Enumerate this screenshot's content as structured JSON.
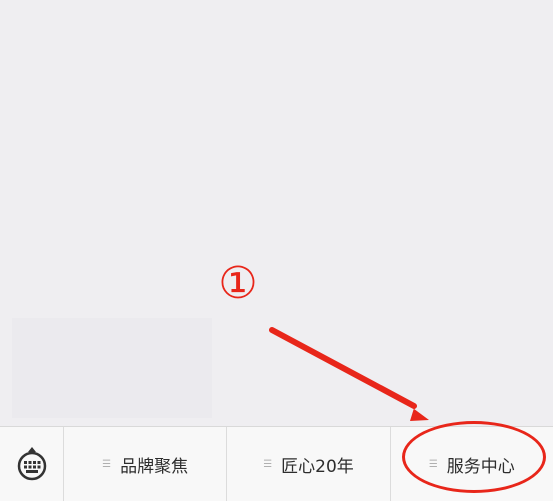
{
  "annotation": {
    "number": "①",
    "color": "#e8261a"
  },
  "menu": {
    "keyboard_icon": "keyboard-icon",
    "items": [
      {
        "icon": "menu-lines-icon",
        "label": "品牌聚焦"
      },
      {
        "icon": "menu-lines-icon",
        "label": "匠心20年"
      },
      {
        "icon": "menu-lines-icon",
        "label": "服务中心"
      }
    ]
  }
}
